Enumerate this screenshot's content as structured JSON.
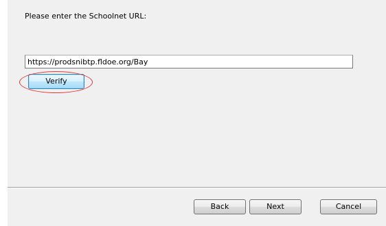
{
  "prompt": {
    "label": "Please enter the Schoolnet URL:"
  },
  "url_field": {
    "value": "https://prodsnibtp.fldoe.org/Bay"
  },
  "verify_button": {
    "label": "Verify"
  },
  "annotation": {
    "highlight_color": "#e33a3a"
  },
  "footer": {
    "back_label": "Back",
    "next_label": "Next",
    "cancel_label": "Cancel"
  }
}
